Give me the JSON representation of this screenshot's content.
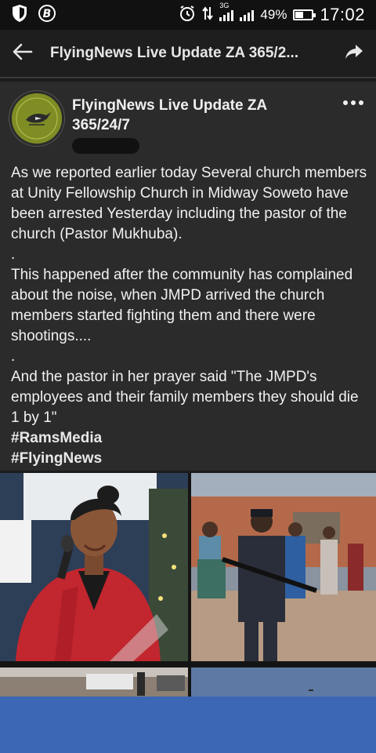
{
  "status_bar": {
    "battery_text": "49%",
    "battery_level": 0.49,
    "network": "3G",
    "time": "17:02"
  },
  "app_bar": {
    "title": "FlyingNews Live Update ZA 365/2..."
  },
  "post": {
    "page_name": "FlyingNews Live Update ZA 365/24/7",
    "paragraphs": [
      "As we reported earlier today Several church members at Unity Fellowship Church in Midway Soweto have been arrested Yesterday including the pastor of the church (Pastor Mukhuba).",
      ".",
      "This happened after the community has complained about the noise, when JMPD arrived the church members started fighting them and there were shootings....",
      ".",
      "And the pastor in her prayer said \"The JMPD's employees and their family members they should die 1 by 1\""
    ],
    "hashtags": [
      "#RamsMedia",
      "#FlyingNews"
    ]
  },
  "icons": {
    "status": [
      "shield-icon",
      "b-coin-icon",
      "alarm-icon",
      "data-arrows-icon",
      "signal-icon",
      "battery-icon"
    ],
    "app_bar": [
      "back-arrow-icon",
      "share-icon"
    ],
    "post": [
      "more-options-icon"
    ]
  },
  "colors": {
    "background": "#1b1b1b",
    "post_background": "#2b2b2b",
    "bottom_bar": "#3b67b4"
  }
}
